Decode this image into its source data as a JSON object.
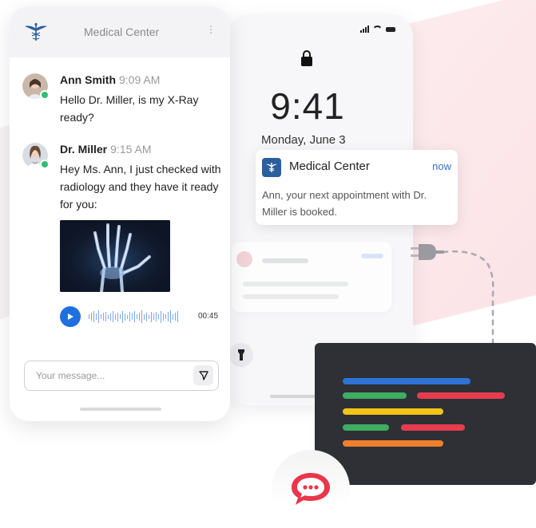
{
  "chat_app": {
    "title": "Medical Center",
    "messages": [
      {
        "author": "Ann Smith",
        "time": "9:09 AM",
        "text": "Hello Dr. Miller, is my X-Ray ready?"
      },
      {
        "author": "Dr. Miller",
        "time": "9:15 AM",
        "text": "Hey Ms. Ann, I just checked with radiology and they have it ready for you:"
      }
    ],
    "audio": {
      "duration": "00:45"
    },
    "composer": {
      "placeholder": "Your message..."
    }
  },
  "lock_screen": {
    "time": "9:41",
    "date": "Monday, June 3",
    "notification": {
      "app": "Medical Center",
      "time": "now",
      "body": "Ann, your next appointment with Dr. Miller is booked."
    }
  },
  "colors": {
    "accent_blue": "#1f6fe0",
    "brand_blue": "#2b5f9e",
    "online_green": "#2fbf71",
    "badge_red": "#e8364b",
    "code_bg": "#2e3036"
  }
}
